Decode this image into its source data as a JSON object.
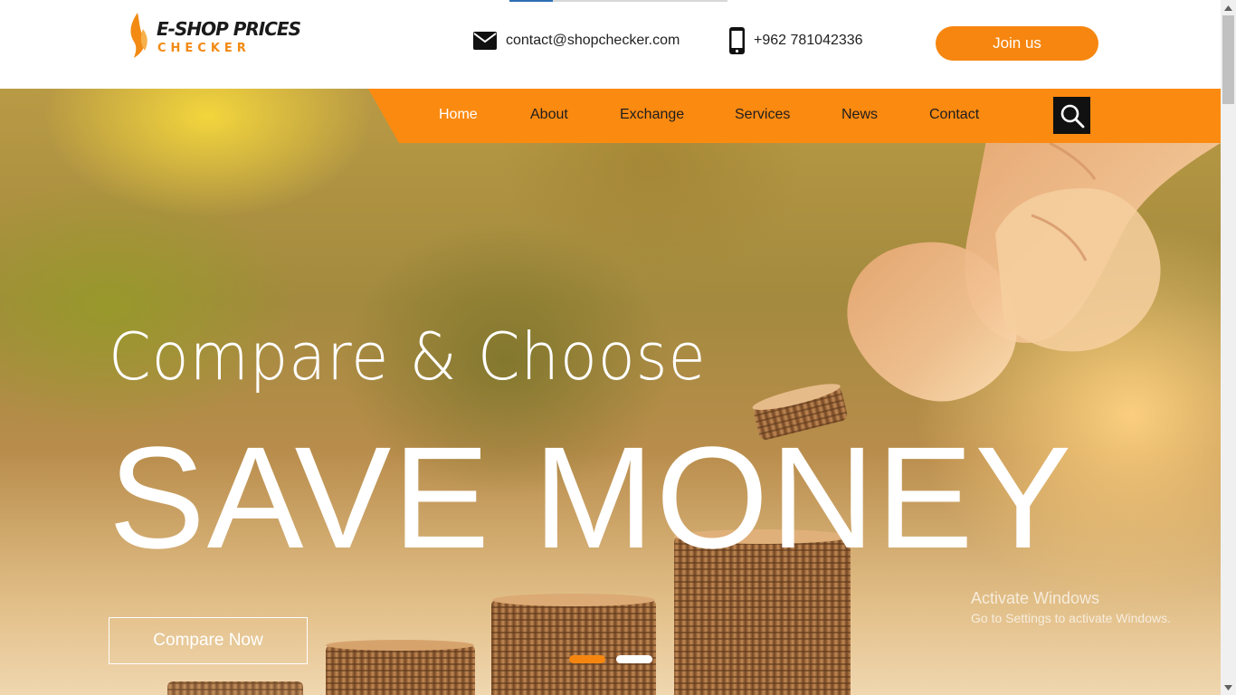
{
  "logo": {
    "title": "E-SHOP PRICES",
    "subtitle": "CHECKER"
  },
  "contact": {
    "email": "contact@shopchecker.com",
    "phone": "+962 781042336"
  },
  "header": {
    "join_label": "Join us"
  },
  "nav": {
    "items": [
      {
        "label": "Home",
        "active": true
      },
      {
        "label": "About"
      },
      {
        "label": "Exchange"
      },
      {
        "label": "Services"
      },
      {
        "label": "News"
      },
      {
        "label": "Contact"
      }
    ]
  },
  "hero": {
    "subtitle": "Compare & Choose",
    "title": "SAVE MONEY",
    "button_label": "Compare Now",
    "slides": 2,
    "active_slide": 1
  },
  "watermark": {
    "title": "Activate Windows",
    "subtitle": "Go to Settings to activate Windows."
  },
  "colors": {
    "accent": "#f6860f",
    "nav_bg": "#fb8a11",
    "search_bg": "#111111",
    "text_dark": "#1e1e1e"
  },
  "icons": {
    "logo": "flame-icon",
    "email": "envelope-icon",
    "phone": "mobile-phone-icon",
    "search": "search-icon"
  }
}
